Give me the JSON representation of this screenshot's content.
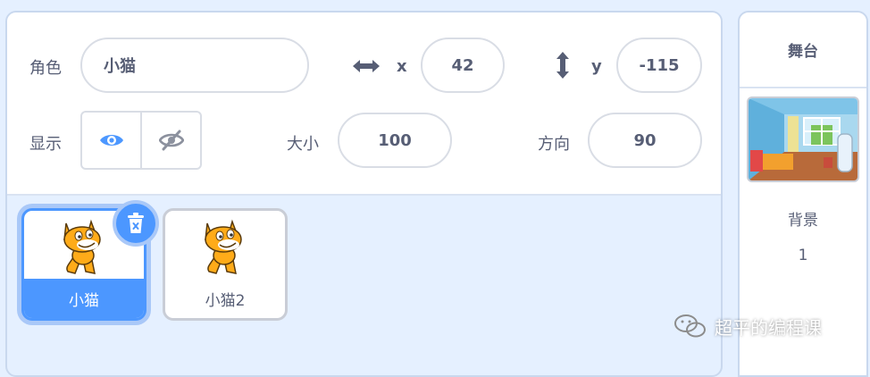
{
  "sprite_info": {
    "sprite_label": "角色",
    "sprite_name": "小猫",
    "x_label": "x",
    "x_value": "42",
    "y_label": "y",
    "y_value": "-115",
    "show_label": "显示",
    "size_label": "大小",
    "size_value": "100",
    "direction_label": "方向",
    "direction_value": "90",
    "visible": true
  },
  "sprites": [
    {
      "name": "小猫",
      "selected": true
    },
    {
      "name": "小猫2",
      "selected": false
    }
  ],
  "stage": {
    "title": "舞台",
    "backdrops_label": "背景",
    "backdrops_count": "1"
  },
  "watermark": {
    "text": "超平的编程课"
  },
  "colors": {
    "accent": "#4c97ff",
    "accent_glow": "#a9c8f8",
    "text": "#575e75",
    "pane_bg": "#e5f0ff"
  }
}
